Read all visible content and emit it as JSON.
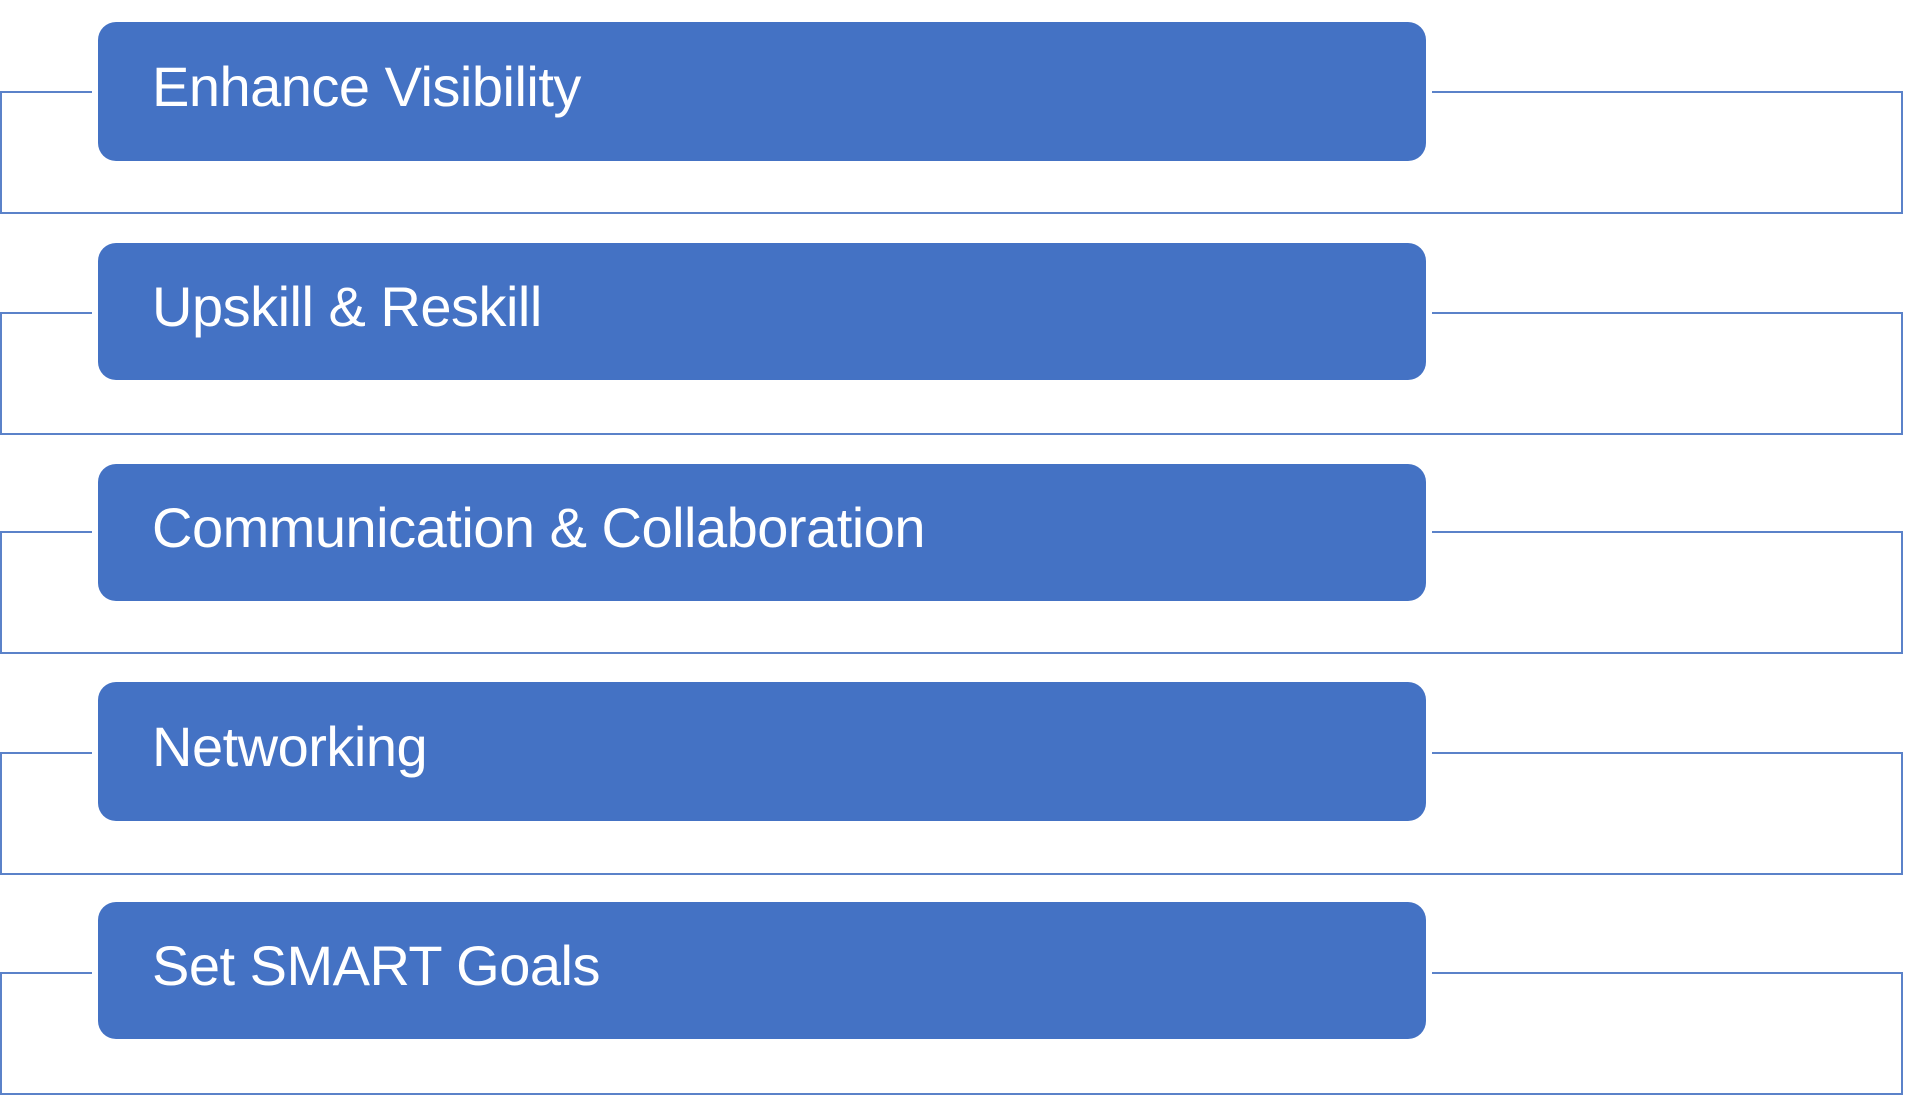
{
  "diagram": {
    "items": [
      {
        "label": "Enhance Visibility"
      },
      {
        "label": "Upskill & Reskill"
      },
      {
        "label": "Communication & Collaboration"
      },
      {
        "label": "Networking"
      },
      {
        "label": "Set SMART Goals"
      }
    ]
  },
  "colors": {
    "box_fill": "#4472c4",
    "connector_line": "#5b82c9",
    "label_text": "#ffffff",
    "background": "#ffffff"
  }
}
